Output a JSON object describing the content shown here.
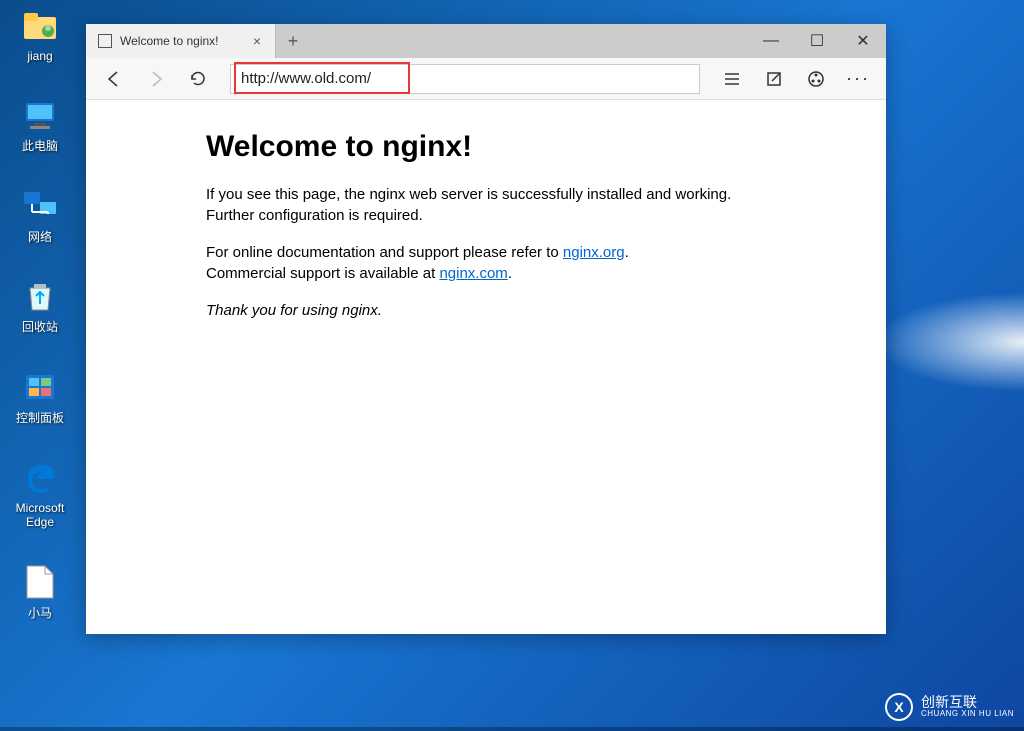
{
  "desktop": {
    "icons": [
      {
        "name": "user-folder-icon",
        "label": "jiang"
      },
      {
        "name": "this-pc-icon",
        "label": "此电脑"
      },
      {
        "name": "network-icon",
        "label": "网络"
      },
      {
        "name": "recycle-bin-icon",
        "label": "回收站"
      },
      {
        "name": "control-panel-icon",
        "label": "控制面板"
      },
      {
        "name": "edge-browser-icon",
        "label": "Microsoft Edge"
      },
      {
        "name": "file-icon",
        "label": "小马"
      }
    ]
  },
  "browser": {
    "tab_title": "Welcome to nginx!",
    "url": "http://www.old.com/",
    "toolbar": {
      "back": "←",
      "forward": "→",
      "refresh": "↻",
      "reading": "≡",
      "notes": "✎",
      "share": "◯",
      "more": "⋯"
    },
    "window_controls": {
      "minimize": "—",
      "maximize": "☐",
      "close": "✕"
    }
  },
  "page": {
    "heading": "Welcome to nginx!",
    "para1": "If you see this page, the nginx web server is successfully installed and working. Further configuration is required.",
    "para2_pre": "For online documentation and support please refer to ",
    "link1": "nginx.org",
    "para2_post": ".",
    "para3_pre": "Commercial support is available at ",
    "link2": "nginx.com",
    "para3_post": ".",
    "thankyou": "Thank you for using nginx."
  },
  "watermark": {
    "badge": "X",
    "main": "创新互联",
    "sub": "CHUANG XIN HU LIAN"
  }
}
